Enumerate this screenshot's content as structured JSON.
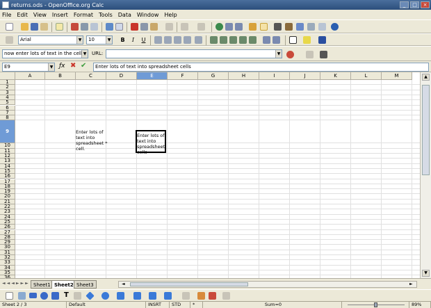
{
  "window": {
    "title": "returns.ods - OpenOffice.org Calc"
  },
  "menu": [
    "File",
    "Edit",
    "View",
    "Insert",
    "Format",
    "Tools",
    "Data",
    "Window",
    "Help"
  ],
  "format_toolbar": {
    "style": "",
    "font": "Arial",
    "size": "10",
    "bold": "B",
    "italic": "I",
    "underline": "U"
  },
  "hyperlink_bar": {
    "text": "now enter lots of text in the cell wi",
    "url_label": "URL:",
    "url_value": ""
  },
  "formula_bar": {
    "cell_ref": "E9",
    "content": "Enter lots of text into spreadsheet cells"
  },
  "columns": [
    "A",
    "B",
    "C",
    "D",
    "E",
    "F",
    "G",
    "H",
    "I",
    "J",
    "K",
    "L",
    "M"
  ],
  "selected_column": "E",
  "rows": [
    "1",
    "2",
    "3",
    "4",
    "5",
    "6",
    "7",
    "8",
    "9",
    "10",
    "11",
    "12",
    "13",
    "14",
    "15",
    "16",
    "17",
    "18",
    "19",
    "20",
    "21",
    "22",
    "23",
    "24",
    "25",
    "26",
    "27",
    "28",
    "29",
    "30",
    "31",
    "32",
    "33",
    "34",
    "35",
    "36",
    "37",
    "38",
    "39"
  ],
  "selected_row": "9",
  "cells": {
    "C9": "Enter lots of\ntext into\nspreadsheet *\ncell.",
    "E9": "Enter lots of\ntext into\nspreadsheet\ncells"
  },
  "sheets": [
    "Sheet1",
    "Sheet2",
    "Sheet3"
  ],
  "active_sheet": "Sheet2",
  "status": {
    "sheet": "Sheet 2 / 3",
    "page_style": "Default",
    "mode": "INSRT",
    "selection": "STD",
    "modified": "*",
    "sum": "Sum=0",
    "zoom": "89%"
  }
}
